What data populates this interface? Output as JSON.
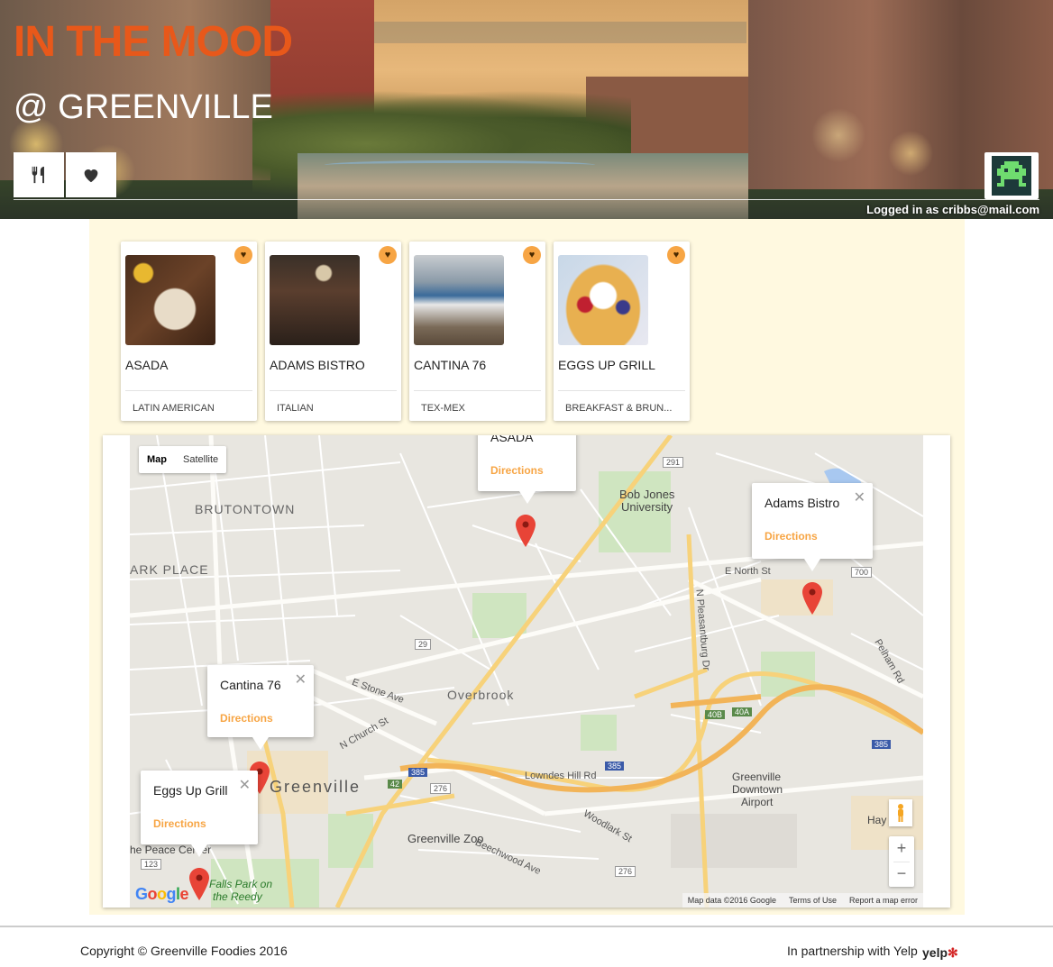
{
  "header": {
    "title": "IN THE MOOD",
    "subtitle": "@ GREENVILLE",
    "logged_in": "Logged in as cribbs@mail.com",
    "icons": {
      "food": "fork-knife-icon",
      "favorites": "heart-icon",
      "avatar": "space-invader-icon"
    }
  },
  "colors": {
    "brand": "#e8581a",
    "accent": "#f7a544",
    "content_bg": "#fff9e0"
  },
  "restaurants": [
    {
      "name": "ASADA",
      "category": "LATIN AMERICAN"
    },
    {
      "name": "ADAMS BISTRO",
      "category": "ITALIAN"
    },
    {
      "name": "CANTINA 76",
      "category": "TEX-MEX"
    },
    {
      "name": "EGGS UP GRILL",
      "category": "BREAKFAST & BRUN..."
    }
  ],
  "map": {
    "type_map": "Map",
    "type_satellite": "Satellite",
    "infowindows": [
      {
        "title": "ASADA",
        "link": "Directions"
      },
      {
        "title": "Adams Bistro",
        "link": "Directions"
      },
      {
        "title": "Cantina 76",
        "link": "Directions"
      },
      {
        "title": "Eggs Up Grill",
        "link": "Directions"
      }
    ],
    "labels": {
      "brutontown": "BRUTONTOWN",
      "park_place": "ARK PLACE",
      "bob_jones": "Bob Jones",
      "university": "University",
      "overbrook": "Overbrook",
      "greenville": "Greenville",
      "greenville_zoo": "Greenville Zoo",
      "airport1": "Greenville",
      "airport2": "Downtown",
      "airport3": "Airport",
      "falls1": "Falls Park on",
      "falls2": "the Reedy",
      "peace": "he Peace Center",
      "e_north": "E North St",
      "e_stone": "E Stone Ave",
      "n_church": "N Church St",
      "pelham": "Pelham Rd",
      "lowndes": "Lowndes Hill Rd",
      "pleasantburg": "N Pleasantburg Dr",
      "woodlark": "Woodlark St",
      "beechwood": "Beechwood Ave",
      "hay": "Hay"
    },
    "shields": [
      "291",
      "29",
      "385",
      "385",
      "385",
      "40B",
      "40A",
      "700",
      "42",
      "276",
      "276",
      "123"
    ],
    "footer": {
      "data": "Map data ©2016 Google",
      "terms": "Terms of Use",
      "report": "Report a map error"
    },
    "google": "Google",
    "zoom_in": "+",
    "zoom_out": "−"
  },
  "footer": {
    "copyright": "Copyright © Greenville Foodies 2016",
    "partner": "In partnership with Yelp",
    "yelp": "yelp"
  }
}
